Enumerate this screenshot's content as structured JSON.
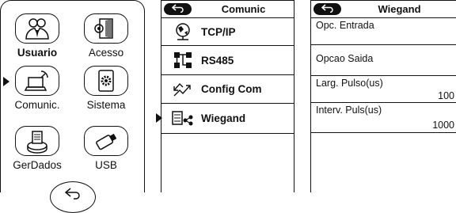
{
  "menu": {
    "tiles": [
      {
        "label": "Usuario",
        "icon": "users-icon"
      },
      {
        "label": "Acesso",
        "icon": "door-icon"
      },
      {
        "label": "Comunic.",
        "icon": "satellite-pc-icon"
      },
      {
        "label": "Sistema",
        "icon": "gear-device-icon"
      },
      {
        "label": "GerDados",
        "icon": "database-icon"
      },
      {
        "label": "USB",
        "icon": "usb-drive-icon"
      }
    ],
    "back_icon": "return-arrow-icon"
  },
  "comm": {
    "title": "Comunic",
    "items": [
      {
        "label": "TCP/IP",
        "icon": "globe-network-icon"
      },
      {
        "label": "RS485",
        "icon": "network-nodes-icon"
      },
      {
        "label": "Config Com",
        "icon": "transfer-arrows-icon"
      },
      {
        "label": "Wiegand",
        "icon": "wiegand-reader-icon"
      }
    ]
  },
  "wiegand": {
    "title": "Wiegand",
    "rows": [
      {
        "label": "Opc. Entrada",
        "value": ""
      },
      {
        "label": "Opcao Saida",
        "value": ""
      },
      {
        "label": "Larg. Pulso(us)",
        "value": "100"
      },
      {
        "label": "Interv. Puls(us)",
        "value": "1000"
      }
    ]
  }
}
